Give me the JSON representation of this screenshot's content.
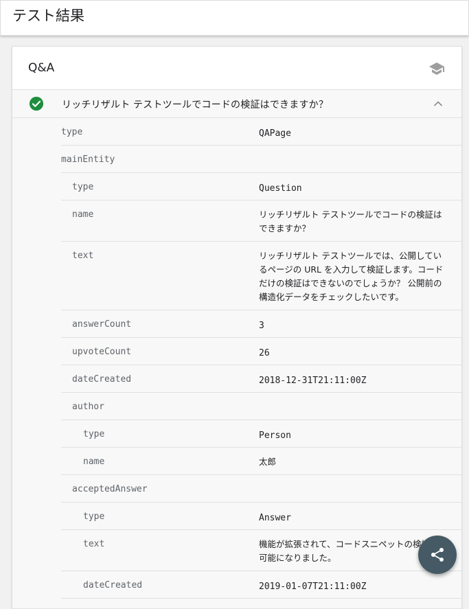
{
  "page": {
    "title": "テスト結果"
  },
  "card": {
    "title": "Q&A",
    "icon": "graduation-cap-icon"
  },
  "item": {
    "title": "リッチリザルト テストツールでコードの検証はできますか？",
    "status_icon": "check-circle-icon",
    "status_color": "#1e8e3e",
    "toggle_icon": "chevron-up-icon"
  },
  "props": [
    {
      "key": "type",
      "value": "QAPage",
      "level": 0
    },
    {
      "key": "mainEntity",
      "value": "",
      "level": 0
    },
    {
      "key": "type",
      "value": "Question",
      "level": 1
    },
    {
      "key": "name",
      "value": "リッチリザルト テストツールでコードの検証はできますか？",
      "level": 1
    },
    {
      "key": "text",
      "value": "リッチリザルト テストツールでは、公開しているページの URL を入力して検証します。コードだけの検証はできないのでしょうか？ 公開前の構造化データをチェックしたいです。",
      "level": 1
    },
    {
      "key": "answerCount",
      "value": "3",
      "level": 1
    },
    {
      "key": "upvoteCount",
      "value": "26",
      "level": 1
    },
    {
      "key": "dateCreated",
      "value": "2018-12-31T21:11:00Z",
      "level": 1
    },
    {
      "key": "author",
      "value": "",
      "level": 1
    },
    {
      "key": "type",
      "value": "Person",
      "level": 2
    },
    {
      "key": "name",
      "value": "太郎",
      "level": 2
    },
    {
      "key": "acceptedAnswer",
      "value": "",
      "level": 1
    },
    {
      "key": "type",
      "value": "Answer",
      "level": 2
    },
    {
      "key": "text",
      "value": "機能が拡張されて、コードスニペットの検証が可能になりました。",
      "level": 2
    },
    {
      "key": "dateCreated",
      "value": "2019-01-07T21:11:00Z",
      "level": 2
    }
  ],
  "fab": {
    "icon": "share-icon"
  }
}
